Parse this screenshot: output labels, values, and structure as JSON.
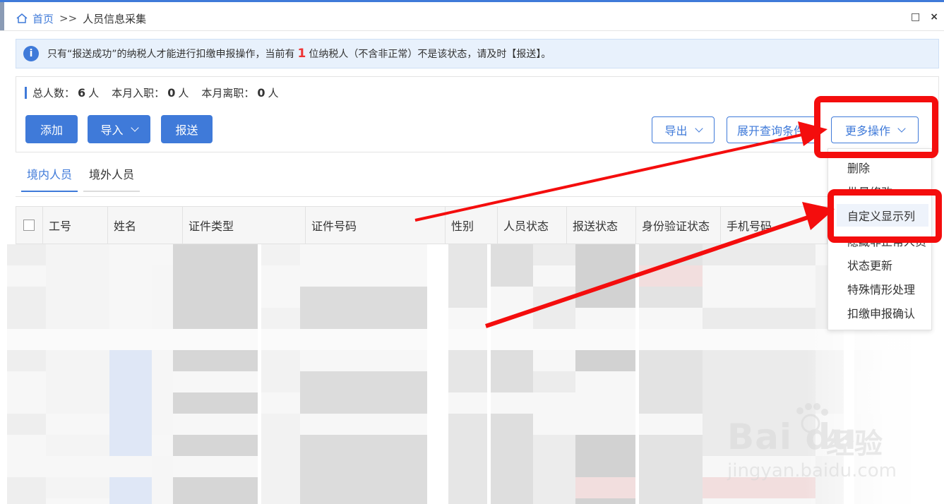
{
  "breadcrumb": {
    "home": "首页",
    "sep": ">>",
    "current": "人员信息采集"
  },
  "window_buttons": [
    "□",
    "×"
  ],
  "notice": {
    "icon": "info-icon",
    "text_before": "只有“报送成功”的纳税人才能进行扣缴申报操作，当前有",
    "count": "1",
    "text_after": "位纳税人（不含非正常）不是该状态，请及时【报送】。"
  },
  "stats": {
    "total_label": "总人数：",
    "total_value": "6",
    "total_unit": "人",
    "hired_label": "本月入职：",
    "hired_value": "0",
    "hired_unit": "人",
    "left_label": "本月离职：",
    "left_value": "0",
    "left_unit": "人"
  },
  "toolbar": {
    "add": "添加",
    "import": "导入",
    "submit": "报送",
    "export": "导出",
    "expand_query": "展开查询条件",
    "more_ops": "更多操作"
  },
  "tabs": [
    {
      "label": "境内人员",
      "active": true
    },
    {
      "label": "境外人员",
      "active": false
    }
  ],
  "table": {
    "headers": [
      "工号",
      "姓名",
      "证件类型",
      "证件号码",
      "性别",
      "人员状态",
      "报送状态",
      "身份验证状态",
      "手机号码"
    ]
  },
  "more_menu": {
    "items": [
      "删除",
      "批量修改",
      "自定义显示列",
      "隐藏非正常人员",
      "状态更新",
      "特殊情形处理",
      "扣缴申报确认"
    ],
    "highlighted": "自定义显示列"
  },
  "watermark": {
    "brand": "Bai du",
    "brand_cn": "经验",
    "url": "jingyan.baidu.com"
  },
  "colors": {
    "accent": "#3f7ad9",
    "annotation_red": "#f40d0d",
    "notice_bg": "#e8f1fc"
  }
}
